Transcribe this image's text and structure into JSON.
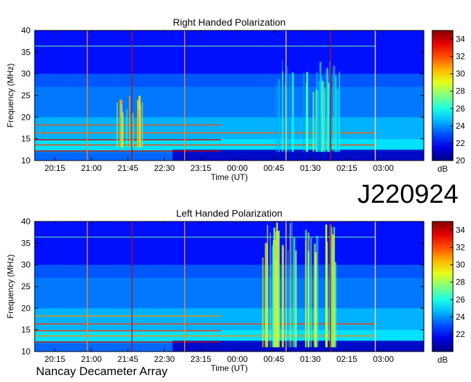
{
  "observation_id": "J220924",
  "footer": "Nancay Decameter Array",
  "chart_data": [
    {
      "type": "heatmap",
      "title": "Right Handed Polarization",
      "xlabel": "Time (UT)",
      "ylabel": "Frequency (MHz)",
      "x_ticks": [
        "20:15",
        "21:00",
        "21:45",
        "22:30",
        "23:15",
        "00:00",
        "00:45",
        "01:30",
        "02:15",
        "03:00"
      ],
      "y_ticks": [
        10,
        15,
        20,
        25,
        30,
        35,
        40
      ],
      "ylim": [
        10,
        40
      ],
      "colorbar": {
        "label": "dB",
        "ticks": [
          20,
          22,
          24,
          26,
          28,
          30,
          32,
          34
        ],
        "range": [
          20,
          35
        ],
        "colormap": "jet"
      },
      "vertical_markers": [
        {
          "time": "20:55",
          "color": "#ff8c1a"
        },
        {
          "time": "21:50",
          "color": "#b01010"
        },
        {
          "time": "22:55",
          "color": "#ff8c1a"
        },
        {
          "time": "01:00",
          "color": "#ffd54a"
        },
        {
          "time": "01:55",
          "color": "#b01010"
        },
        {
          "time": "02:50",
          "color": "#ffe08a"
        }
      ],
      "features": [
        {
          "name": "burst",
          "time_start": "21:30",
          "time_end": "22:10",
          "freq_low": 13,
          "freq_high": 25,
          "level_db": 29
        },
        {
          "name": "striations",
          "time_start": "00:45",
          "time_end": "02:15",
          "freq_low": 12,
          "freq_high": 33,
          "level_db": 26
        }
      ]
    },
    {
      "type": "heatmap",
      "title": "Left Handed Polarization",
      "xlabel": "Time (UT)",
      "ylabel": "Frequency (MHz)",
      "x_ticks": [
        "20:15",
        "21:00",
        "21:45",
        "22:30",
        "23:15",
        "00:00",
        "00:45",
        "01:30",
        "02:15",
        "03:00"
      ],
      "y_ticks": [
        10,
        15,
        20,
        25,
        30,
        35,
        40
      ],
      "ylim": [
        10,
        40
      ],
      "colorbar": {
        "label": "dB",
        "ticks": [
          22,
          24,
          26,
          28,
          30,
          32,
          34
        ],
        "range": [
          20,
          35
        ],
        "colormap": "jet"
      },
      "vertical_markers": [
        {
          "time": "20:55",
          "color": "#ff8c1a"
        },
        {
          "time": "21:50",
          "color": "#b01010"
        },
        {
          "time": "22:55",
          "color": "#ff8c1a"
        },
        {
          "time": "01:00",
          "color": "#ffd54a"
        },
        {
          "time": "01:55",
          "color": "#b01010"
        },
        {
          "time": "02:50",
          "color": "#ffe08a"
        }
      ],
      "features": [
        {
          "name": "burst",
          "time_start": "00:30",
          "time_end": "02:00",
          "freq_low": 11,
          "freq_high": 40,
          "level_db": 28
        }
      ]
    }
  ]
}
